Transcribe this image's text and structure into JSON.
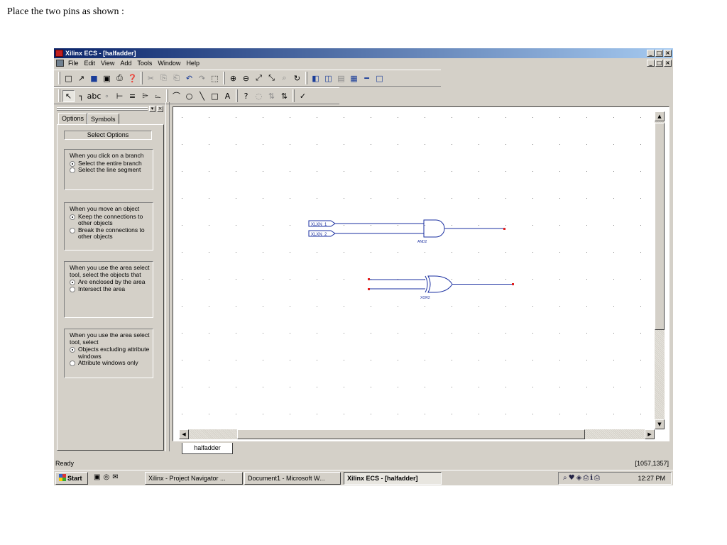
{
  "caption": "Place the two pins as shown :",
  "window": {
    "title": "Xilinx ECS - [halfadder]",
    "controls": [
      "_",
      "□",
      "×"
    ]
  },
  "menu": [
    "File",
    "Edit",
    "View",
    "Add",
    "Tools",
    "Window",
    "Help"
  ],
  "toolbar1": [
    "□",
    "↗",
    "■",
    "▣",
    "⎙",
    "❓",
    "✂",
    "⎘",
    "⎗",
    "↶",
    "↷",
    "⬚",
    "⊕",
    "⊖",
    "⤢",
    "⤡",
    "⌕",
    "↻",
    "◧",
    "◫",
    "▤",
    "▦",
    "━",
    "□"
  ],
  "toolbar2": [
    "↖",
    "┐",
    "abc",
    "∘",
    "⊢",
    "≡",
    "⌲",
    "⌳",
    "⌒",
    "○",
    "╲",
    "□",
    "A",
    "?",
    "◌",
    "⇅",
    "⇅",
    "✓"
  ],
  "panel": {
    "tabs": [
      "Options",
      "Symbols"
    ],
    "header": "Select Options",
    "groups": [
      {
        "question": "When you click on a branch",
        "options": [
          {
            "label": "Select the entire branch",
            "selected": true
          },
          {
            "label": "Select the line segment",
            "selected": false
          }
        ]
      },
      {
        "question": "When you move an object",
        "options": [
          {
            "label": "Keep the connections to other objects",
            "selected": true
          },
          {
            "label": "Break the connections to other objects",
            "selected": false
          }
        ]
      },
      {
        "question": "When you use the area select tool, select the objects that",
        "options": [
          {
            "label": "Are enclosed by the area",
            "selected": true
          },
          {
            "label": "Intersect the area",
            "selected": false
          }
        ]
      },
      {
        "question": "When you use the area select tool, select",
        "options": [
          {
            "label": "Objects excluding attribute windows",
            "selected": true
          },
          {
            "label": "Attribute windows only",
            "selected": false
          }
        ]
      }
    ]
  },
  "schematic": {
    "pins": [
      "XLXN_1",
      "XLXN_2"
    ],
    "gates": [
      "AND2",
      "XOR2"
    ],
    "wire_color": "#1a2fa0",
    "pin_dot_color": "#e02020"
  },
  "doc_tab": "halfadder",
  "status": {
    "left": "Ready",
    "right": "[1057,1357]"
  },
  "taskbar": {
    "start": "Start",
    "tasks": [
      "Xilinx - Project Navigator ...",
      "Document1 - Microsoft W...",
      "Xilinx ECS - [halfadder]"
    ],
    "clock": "12:27 PM"
  }
}
